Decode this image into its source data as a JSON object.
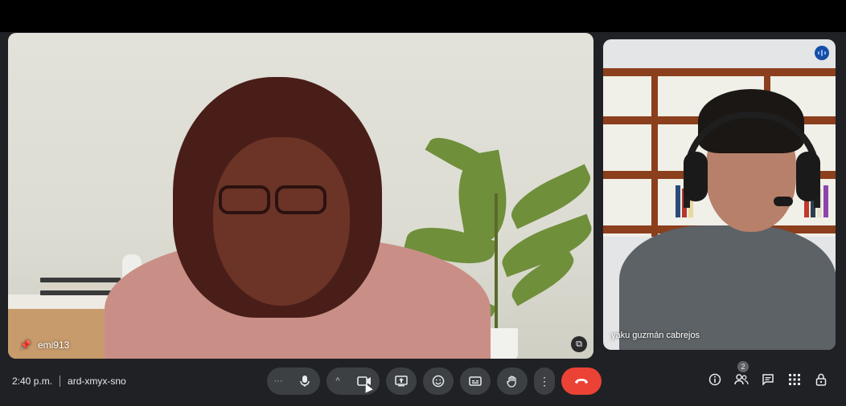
{
  "participants": {
    "main": {
      "name": "emi913",
      "pinned": true
    },
    "side": {
      "name": "yaku guzmán cabrejos",
      "speaking": true
    }
  },
  "meeting": {
    "time": "2:40 p.m.",
    "code": "ard-xmyx-sno"
  },
  "controls": {
    "more_dots_label": "···",
    "mic_icon": "mic-icon",
    "camera_options_label": "^",
    "camera_icon": "camera-icon",
    "present_icon": "present-screen-icon",
    "reactions_icon": "emoji-icon",
    "captions_icon": "captions-icon",
    "raise_hand_icon": "raise-hand-icon",
    "more_options_label": "⋮",
    "end_call_icon": "end-call-icon"
  },
  "side_panel": {
    "people_count": "2"
  },
  "colors": {
    "background": "#202124",
    "control_bg": "#3c4043",
    "end_call": "#ea4335",
    "speaking_indicator": "#174ea6"
  }
}
